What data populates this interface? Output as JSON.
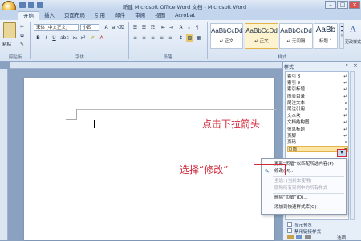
{
  "window": {
    "title": "新建 Microsoft Office Word 文档 - Microsoft Word"
  },
  "tabs": [
    "开始",
    "插入",
    "页面布局",
    "引用",
    "邮件",
    "审阅",
    "视图",
    "Acrobat"
  ],
  "clipboard": {
    "paste": "粘贴",
    "group": "剪贴板"
  },
  "font": {
    "name": "宋体 (中文正文)",
    "size": "小四",
    "group": "字体"
  },
  "paragraph": {
    "group": "段落"
  },
  "styles": {
    "group": "样式",
    "items": [
      {
        "preview": "AaBbCcDd",
        "label": "↵ 正文"
      },
      {
        "preview": "AaBbCcDd",
        "label": "↵ 无间隔"
      },
      {
        "preview": "AaBb",
        "label": "标题 1"
      }
    ],
    "change": "更改样式"
  },
  "pane": {
    "title": "样式",
    "items": [
      {
        "label": "索引 8",
        "mark": "↵"
      },
      {
        "label": "索引 9",
        "mark": "↵"
      },
      {
        "label": "索引标题",
        "mark": "↵"
      },
      {
        "label": "图表目录",
        "mark": "↵"
      },
      {
        "label": "尾注文本",
        "mark": "a"
      },
      {
        "label": "尾注引用",
        "mark": "a"
      },
      {
        "label": "文本块",
        "mark": "↵"
      },
      {
        "label": "文档结构图",
        "mark": "↵"
      },
      {
        "label": "信息标题",
        "mark": "↵"
      },
      {
        "label": "页脚",
        "mark": "↵"
      },
      {
        "label": "页码",
        "mark": "a"
      },
      {
        "label": "页眉",
        "mark": "▾"
      }
    ],
    "show_preview": "显示预览",
    "disable_linked": "禁用链接样式",
    "new_style": "选项..."
  },
  "context_menu": {
    "items": [
      {
        "label": "更新“页眉”以匹配所选内容(P)",
        "enabled": true
      },
      {
        "label": "修改(M)...",
        "enabled": true
      },
      {
        "label": "全选: (当前未使用)",
        "enabled": false
      },
      {
        "label": "删除所有实例中的所有样式",
        "enabled": false
      },
      {
        "label": "删除“页眉”(D)...",
        "enabled": true
      },
      {
        "label": "添加到快速样式库(Q)",
        "enabled": true
      }
    ]
  },
  "annotations": {
    "click_arrow": "点击下拉箭头",
    "choose_modify": "选择“修改”"
  }
}
